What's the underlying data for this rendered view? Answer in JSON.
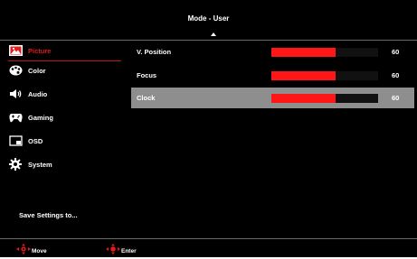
{
  "header": {
    "title": "Mode - User"
  },
  "sidebar": {
    "items": [
      {
        "label": "Picture",
        "icon": "picture-icon",
        "active": true
      },
      {
        "label": "Color",
        "icon": "color-palette-icon",
        "active": false
      },
      {
        "label": "Audio",
        "icon": "speaker-icon",
        "active": false
      },
      {
        "label": "Gaming",
        "icon": "gamepad-icon",
        "active": false
      },
      {
        "label": "OSD",
        "icon": "osd-window-icon",
        "active": false
      },
      {
        "label": "System",
        "icon": "gear-icon",
        "active": false
      }
    ],
    "save_label": "Save Settings to..."
  },
  "settings": [
    {
      "label": "V. Position",
      "value": "60",
      "level": 0.6,
      "selected": false
    },
    {
      "label": "Focus",
      "value": "60",
      "level": 0.6,
      "selected": false
    },
    {
      "label": "Clock",
      "value": "60",
      "level": 0.6,
      "selected": true
    }
  ],
  "footer": {
    "move_label": "Move",
    "enter_label": "Enter",
    "move_icon": "dpad-move-icon",
    "enter_icon": "dpad-enter-icon"
  },
  "colors": {
    "accent": "#e21b1b",
    "bar_fill": "#ff1616",
    "background": "#000000",
    "selected_row": "#8e8e8e",
    "divider": "#6a6a6a"
  }
}
